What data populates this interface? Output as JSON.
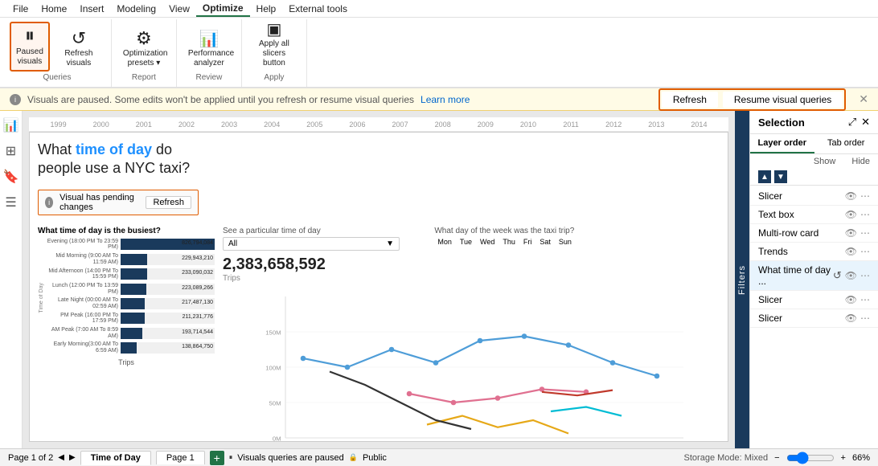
{
  "menubar": {
    "items": [
      "File",
      "Home",
      "Insert",
      "Modeling",
      "View",
      "Optimize",
      "Help",
      "External tools"
    ],
    "active": "Optimize"
  },
  "ribbon": {
    "groups": [
      {
        "label": "Queries",
        "buttons": [
          {
            "id": "paused-visuals",
            "icon": "⏸",
            "label": "Paused\nvisuals",
            "active": true
          },
          {
            "id": "refresh-visuals",
            "icon": "↺",
            "label": "Refresh\nvisuals",
            "active": false
          }
        ]
      },
      {
        "label": "Report",
        "buttons": [
          {
            "id": "optimization-presets",
            "icon": "⚙",
            "label": "Optimization\npresets ▾",
            "active": false
          }
        ]
      },
      {
        "label": "Review",
        "buttons": [
          {
            "id": "performance-analyzer",
            "icon": "📊",
            "label": "Performance\nanalyzer",
            "active": false
          }
        ]
      },
      {
        "label": "Apply",
        "buttons": [
          {
            "id": "apply-all-slicers",
            "icon": "⬛",
            "label": "Apply all slicers\nbutton",
            "active": false
          }
        ]
      }
    ]
  },
  "warning_bar": {
    "text": "Visuals are paused. Some edits won't be applied until you refresh or resume visual queries",
    "link_text": "Learn more",
    "refresh_btn": "Refresh",
    "resume_btn": "Resume visual queries"
  },
  "timeline": {
    "years": [
      "1999",
      "2000",
      "2001",
      "2002",
      "2003",
      "2004",
      "2005",
      "2006",
      "2007",
      "2008",
      "2009",
      "2010",
      "2011",
      "2012",
      "2013",
      "2014"
    ]
  },
  "canvas": {
    "heading_part1": "What ",
    "heading_highlight": "time of day",
    "heading_part2": " do\npeople use a NYC taxi?",
    "pending_text": "Visual has pending changes",
    "pending_btn": "Refresh",
    "filter_label": "See a particular time of day",
    "filter_value": "All",
    "day_filter_label": "What day of the week was the taxi trip?",
    "days": [
      "Mon",
      "Tue",
      "Wed",
      "Thu",
      "Fri",
      "Sat",
      "Sun"
    ],
    "big_count": "2,383,658,592",
    "count_label": "Trips",
    "busiest_label": "What time of day is the busiest?",
    "bars": [
      {
        "label": "Evening (18:00 PM To 23:59 PM)",
        "value": 826794084,
        "display": "826,794,084",
        "pct": 100
      },
      {
        "label": "Mid Morning (9:00 AM To 11:59 AM)",
        "value": 229943210,
        "display": "229,943,210",
        "pct": 28
      },
      {
        "label": "Mid Afternoon (14:00 PM To 15:59 PM)",
        "value": 233090032,
        "display": "233,090,032",
        "pct": 28
      },
      {
        "label": "Lunch (12:00 PM To 13:59 PM)",
        "value": 223089266,
        "display": "223,089,266",
        "pct": 27
      },
      {
        "label": "Late Night (00:00 AM To 02:59 AM)",
        "value": 217487130,
        "display": "217,487,130",
        "pct": 26
      },
      {
        "label": "PM Peak (16:00 PM To 17:59 PM)",
        "value": 211231776,
        "display": "211,231,776",
        "pct": 26
      },
      {
        "label": "AM Peak (7:00 AM To 8:59 AM)",
        "value": 193714544,
        "display": "193,714,544",
        "pct": 23
      },
      {
        "label": "Early Morning(3:00 AM To 6:59 AM)",
        "value": 138864750,
        "display": "138,864,750",
        "pct": 17
      }
    ],
    "bar_y_label": "Time of Day",
    "bar_x_label": "Trips"
  },
  "selection_panel": {
    "title": "Selection",
    "tabs": [
      "Layer order",
      "Tab order"
    ],
    "show_hide": [
      "Show",
      "Hide"
    ],
    "items": [
      {
        "label": "Slicer",
        "eye": true,
        "dots": true,
        "highlight": false,
        "refresh": false
      },
      {
        "label": "Text box",
        "eye": true,
        "dots": true,
        "highlight": false,
        "refresh": false
      },
      {
        "label": "Multi-row card",
        "eye": true,
        "dots": true,
        "highlight": false,
        "refresh": false
      },
      {
        "label": "Trends",
        "eye": true,
        "dots": true,
        "highlight": false,
        "refresh": false
      },
      {
        "label": "What time of day ...",
        "eye": true,
        "dots": true,
        "highlight": true,
        "refresh": true
      },
      {
        "label": "Slicer",
        "eye": true,
        "dots": true,
        "highlight": false,
        "refresh": false
      },
      {
        "label": "Slicer",
        "eye": true,
        "dots": true,
        "highlight": false,
        "refresh": false
      }
    ]
  },
  "status_bar": {
    "page_indicator": "Page 1 of 2",
    "paused_text": "Visuals queries are paused",
    "public_text": "Public",
    "storage_mode": "Storage Mode: Mixed",
    "zoom": "66%",
    "pages": [
      {
        "label": "Time of Day",
        "active": true
      },
      {
        "label": "Page 1",
        "active": false
      }
    ],
    "add_page": "+"
  }
}
